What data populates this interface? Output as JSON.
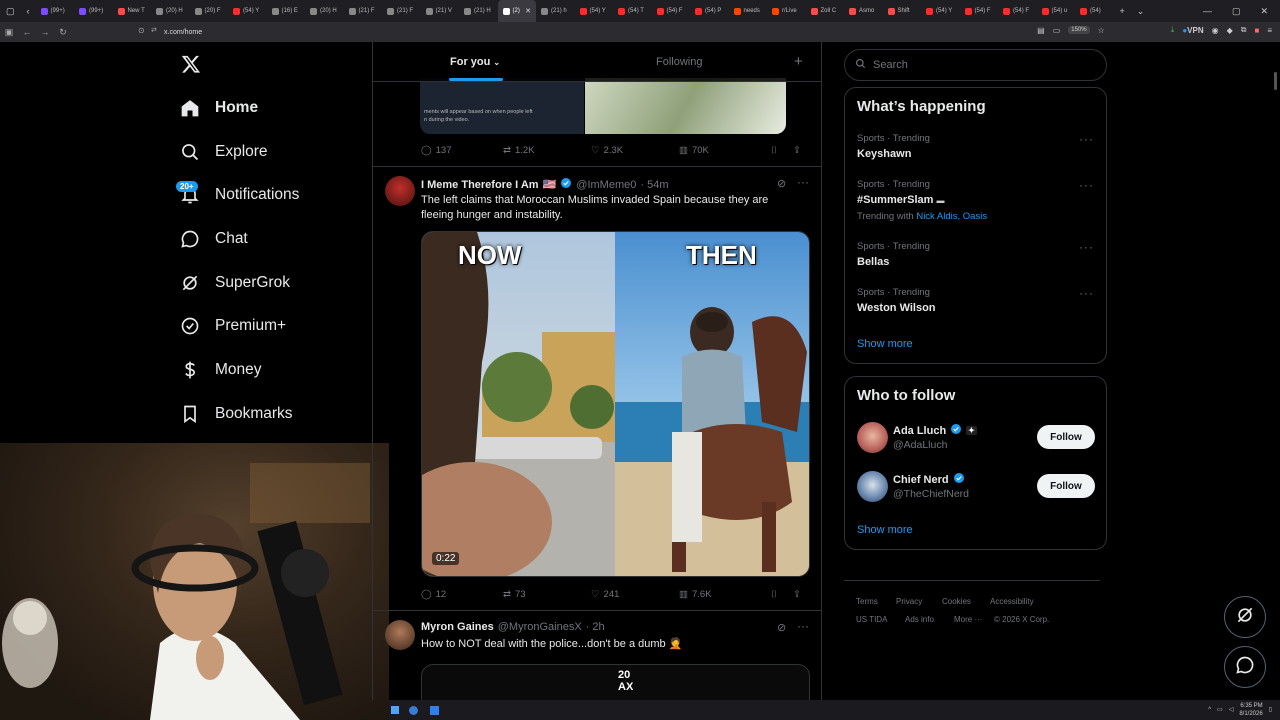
{
  "browser": {
    "tabs": [
      {
        "label": "(99+)",
        "color": "#7c4dff"
      },
      {
        "label": "(99+)",
        "color": "#7c4dff"
      },
      {
        "label": "New T",
        "color": "#ff4a4a"
      },
      {
        "label": "(20) H",
        "color": "#888888"
      },
      {
        "label": "(20) F",
        "color": "#888888"
      },
      {
        "label": "(54) Y",
        "color": "#ff2a2a"
      },
      {
        "label": "(16) E",
        "color": "#888888"
      },
      {
        "label": "(20) H",
        "color": "#888888"
      },
      {
        "label": "(21) F",
        "color": "#888888"
      },
      {
        "label": "(21) F",
        "color": "#888888"
      },
      {
        "label": "(21) V",
        "color": "#888888"
      },
      {
        "label": "(21) H",
        "color": "#888888"
      },
      {
        "label": "(2) ",
        "color": "#ffffff"
      },
      {
        "label": "(21) h",
        "color": "#888888"
      },
      {
        "label": "(54) Y",
        "color": "#ff2a2a"
      },
      {
        "label": "(54) T",
        "color": "#ff2a2a"
      },
      {
        "label": "(54) F",
        "color": "#ff2a2a"
      },
      {
        "label": "(54) P",
        "color": "#ff2a2a"
      },
      {
        "label": "needs",
        "color": "#ff4500"
      },
      {
        "label": "r/Live",
        "color": "#ff4500"
      },
      {
        "label": "Zoll C",
        "color": "#ff4a4a"
      },
      {
        "label": "Asmo",
        "color": "#ff4a4a"
      },
      {
        "label": "Shift",
        "color": "#ff4a4a"
      },
      {
        "label": "(54) Y",
        "color": "#ff2a2a"
      },
      {
        "label": "(54) F",
        "color": "#ff2a2a"
      },
      {
        "label": "(54) F",
        "color": "#ff2a2a"
      },
      {
        "label": "(54) u",
        "color": "#ff2a2a"
      },
      {
        "label": "(54) ",
        "color": "#ff2a2a"
      }
    ],
    "active_tab_index": 12,
    "url": "x.com/home",
    "zoom": "150%",
    "vpn_label": "VPN"
  },
  "nav": {
    "items": [
      {
        "label": "Home",
        "icon": "home-icon"
      },
      {
        "label": "Explore",
        "icon": "search-icon"
      },
      {
        "label": "Notifications",
        "icon": "bell-icon"
      },
      {
        "label": "Chat",
        "icon": "chat-icon"
      },
      {
        "label": "SuperGrok",
        "icon": "grok-icon"
      },
      {
        "label": "Premium+",
        "icon": "verified-icon"
      },
      {
        "label": "Money",
        "icon": "money-icon"
      },
      {
        "label": "Bookmarks",
        "icon": "bookmark-icon"
      }
    ],
    "notifications_badge": "20+"
  },
  "feed": {
    "tabs": {
      "for_you": "For you",
      "following": "Following"
    },
    "prev_tweet": {
      "image_caption": "ments will appear based on when people left\nn during the video.",
      "replies": "137",
      "reposts": "1.2K",
      "likes": "2.3K",
      "views": "70K"
    },
    "tweet1": {
      "name": "I Meme Therefore I Am",
      "flag": "🇺🇸",
      "handle": "@ImMeme0",
      "time": "· 54m",
      "text": "The left claims that Moroccan Muslims invaded Spain because they are fleeing hunger and instability.",
      "video_left_caption": "NOW",
      "video_right_caption": "THEN",
      "video_duration": "0:22",
      "replies": "12",
      "reposts": "73",
      "likes": "241",
      "views": "7.6K"
    },
    "tweet2": {
      "name": "Myron Gaines",
      "handle": "@MyronGainesX",
      "time": "· 2h",
      "text": "How to NOT deal with the police...don't be a dumb 🤦",
      "media_text": "20\nAX"
    }
  },
  "sidebar": {
    "search_placeholder": "Search",
    "whats_happening": {
      "title": "What’s happening",
      "trends": [
        {
          "category": "Sports · Trending",
          "name": "Keyshawn"
        },
        {
          "category": "Sports · Trending",
          "name": "#SummerSlam",
          "extra_prefix": "Trending with",
          "extra_links": "Nick Aldis, Oasis"
        },
        {
          "category": "Sports · Trending",
          "name": "Bellas"
        },
        {
          "category": "Sports · Trending",
          "name": "Weston Wilson"
        }
      ],
      "show_more": "Show more"
    },
    "who_to_follow": {
      "title": "Who to follow",
      "accounts": [
        {
          "name": "Ada Lluch",
          "handle": "@AdaLluch",
          "button": "Follow"
        },
        {
          "name": "Chief Nerd",
          "handle": "@TheChiefNerd",
          "button": "Follow"
        }
      ],
      "show_more": "Show more"
    },
    "footer": {
      "links": [
        "Terms",
        "Privacy",
        "Cookies",
        "Accessibility",
        "US TIDA",
        "Ads info",
        "More ···"
      ],
      "copyright": "© 2026 X Corp."
    }
  },
  "taskbar": {
    "time": "6:35 PM",
    "date": "8/1/2026"
  },
  "colors": {
    "accent": "#1d9bf0",
    "background": "#000000",
    "border": "#2f3336",
    "muted_text": "#71767b"
  }
}
